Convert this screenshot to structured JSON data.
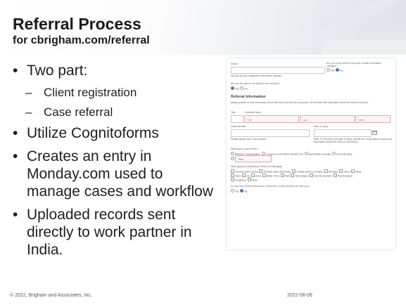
{
  "slide": {
    "title": "Referral Process",
    "subtitle": "for cbrigham.com/referral",
    "bullets": [
      "Two part:",
      "Client registration",
      "Case referral",
      "Utilize Cognitoforms",
      "Creates an entry in Monday.com used to manage cases and workflow",
      "Uploaded records sent directly to work partner in India."
    ],
    "bullet_glyph": "•",
    "dash_glyph": "–"
  },
  "form": {
    "email_label": "Email *",
    "edit_note": "Will ask as your registration information appears",
    "new_client_q": "Are you a new client or has your contact information changed?",
    "yes": "Yes",
    "no": "No",
    "billed_q": "Are you the client to be billed for the services?",
    "section_title": "Referral Information",
    "section_desc": "please provide us with information about this case and how we can assist. We will start with information about the person involved.",
    "title_label": "Title",
    "claimant_label": "Claimant Name",
    "first_ph": "First",
    "last_ph": "Last",
    "suffix_ph": "Suffix",
    "claim_number_label": "Claim Number",
    "date_label": "Date of Injury",
    "claim_hint": "Please specify your case number.",
    "date_hint": "Note: If more than one date of injury, specify one of the dates of injury and information about the others in comments.",
    "case_type_q": "What type of case is this?",
    "case_types": [
      "Workers' Compensation",
      "Longshore and Harbor Workers Act",
      "Automobile Casualty",
      "Personal Injury",
      "Other"
    ],
    "problems_q": "What type(s) of problem(s)? Select all that apply.",
    "problems": [
      "Cervical spine (Neck)",
      "Thoracic spine (Mid back)",
      "Lumbar spine (Low back)",
      "Shoulder",
      "Elbow",
      "Wrist",
      "Hand",
      "Hip",
      "Knee",
      "Ankle / Foot",
      "Pain",
      "Neurological",
      "Internal medicine",
      "Psychological",
      "Vocational",
      "Other"
    ],
    "further_q": "Do you need further information, at this time, on the services we offer you?"
  },
  "footer": {
    "copyright": "© 2022, Brigham and Associates, Inc.",
    "date": "2022-08-06"
  },
  "colors": {
    "required_border": "#e1a8a8",
    "radio_selected": "#4a7ab0"
  }
}
